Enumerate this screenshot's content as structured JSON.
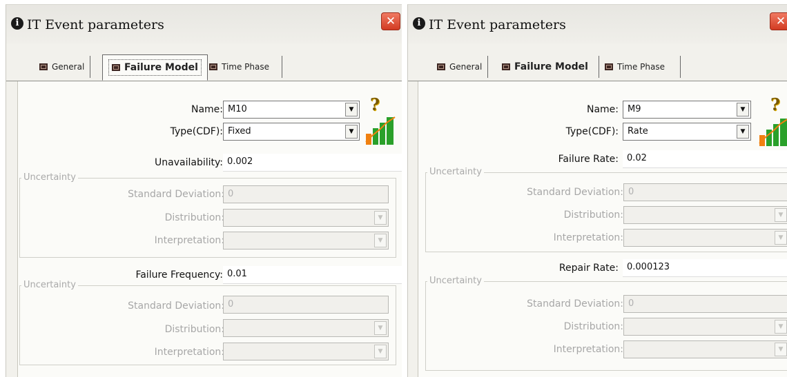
{
  "dialogs": [
    {
      "title": "IT Event parameters",
      "close_icon": "close-icon",
      "tabs": [
        {
          "label": "General"
        },
        {
          "label": "Failure Model",
          "active": true
        },
        {
          "label": "Time Phase"
        }
      ],
      "fields": {
        "name_label": "Name:",
        "name_value": "M10",
        "type_label": "Type(CDF):",
        "type_value": "Fixed",
        "param1_label": "Unavailability:",
        "param1_value": "0.002",
        "uncertainty_label": "Uncertainty",
        "std_label": "Standard Deviation:",
        "std_value": "0",
        "dist_label": "Distribution:",
        "interp_label": "Interpretation:",
        "param2_label": "Failure Frequency:",
        "param2_value": "0.01",
        "uncertainty2_label": "Uncertainty",
        "std2_label": "Standard Deviation:",
        "std2_value": "0",
        "dist2_label": "Distribution:",
        "interp2_label": "Interpretation:"
      }
    },
    {
      "title": "IT Event parameters",
      "close_icon": "close-icon",
      "tabs": [
        {
          "label": "General"
        },
        {
          "label": "Failure Model",
          "active": true
        },
        {
          "label": "Time Phase"
        }
      ],
      "fields": {
        "name_label": "Name:",
        "name_value": "M9",
        "type_label": "Type(CDF):",
        "type_value": "Rate",
        "param1_label": "Failure Rate:",
        "param1_value": "0.02",
        "uncertainty_label": "Uncertainty",
        "std_label": "Standard Deviation:",
        "std_value": "0",
        "dist_label": "Distribution:",
        "interp_label": "Interpretation:",
        "param2_label": "Repair Rate:",
        "param2_value": "0.000123",
        "uncertainty2_label": "Uncertainty",
        "std2_label": "Standard Deviation:",
        "std2_value": "0",
        "dist2_label": "Distribution:",
        "interp2_label": "Interpretation:"
      }
    }
  ],
  "icons": {
    "info": "info-icon",
    "help": "help-icon",
    "chart": "bar-chart-icon",
    "tab": "tab-icon",
    "dropdown": "chevron-down-icon"
  },
  "colors": {
    "close_button": "#d23b22",
    "disabled_text": "#a7a7a7",
    "chart_green": "#2aa02a",
    "chart_orange": "#f08010"
  }
}
